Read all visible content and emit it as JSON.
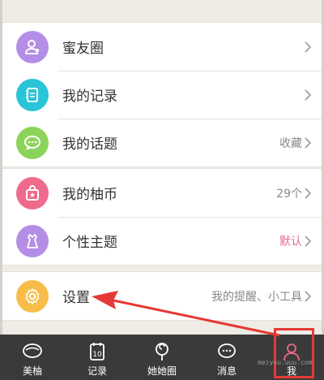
{
  "menu_group_1": [
    {
      "label": "蜜友圈",
      "right": "",
      "icon": "friends-icon",
      "color": "#b48ee6"
    },
    {
      "label": "我的记录",
      "right": "",
      "icon": "notebook-icon",
      "color": "#29c4d6"
    },
    {
      "label": "我的话题",
      "right": "收藏",
      "icon": "chat-bubble-icon",
      "color": "#8cd35a"
    }
  ],
  "menu_group_2": [
    {
      "label": "我的柚币",
      "right": "29个",
      "icon": "shopping-bag-icon",
      "color": "#f06a8c"
    },
    {
      "label": "个性主题",
      "right": "默认",
      "icon": "dress-icon",
      "color": "#b48ee6"
    }
  ],
  "menu_group_3": [
    {
      "label": "设置",
      "right": "我的提醒、小工具",
      "icon": "gear-icon",
      "color": "#f7bd48"
    }
  ],
  "tabbar": [
    {
      "label": "美柚",
      "icon": "bowl-icon"
    },
    {
      "label": "记录",
      "icon": "calendar-icon"
    },
    {
      "label": "她她圈",
      "icon": "lollipop-icon"
    },
    {
      "label": "消息",
      "icon": "message-icon"
    },
    {
      "label": "我",
      "icon": "profile-icon"
    }
  ],
  "calendar_day": "10",
  "watermark": "meiyou.uuu.com",
  "annotation_color": "#e53935"
}
